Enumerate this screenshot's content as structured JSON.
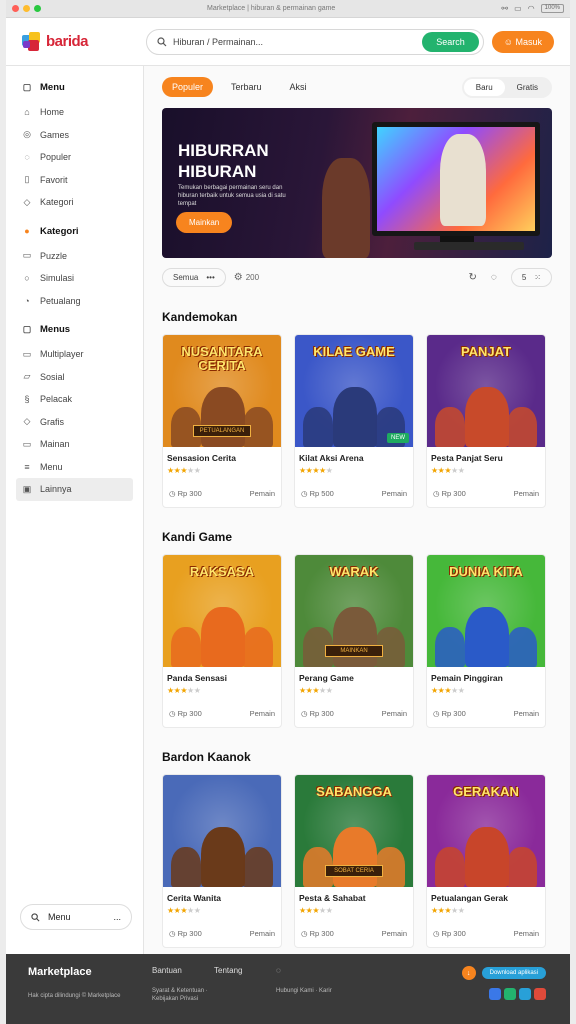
{
  "titlebar": {
    "traffic_lights": [
      "#ff5f57",
      "#febc2e",
      "#28c840"
    ],
    "title": "Marketplace | hiburan & permainan game",
    "status_battery": "100%"
  },
  "header": {
    "brand": "barida",
    "search_placeholder": "Hiburan / Permainan...",
    "search_button": "Search",
    "account_button": "Masuk"
  },
  "sidebar": {
    "section1_title": "Menu",
    "section1_items": [
      "Home",
      "Games",
      "Populer",
      "Favorit",
      "Kategori"
    ],
    "section2_title": "Kategori",
    "section2_items": [
      "Puzzle",
      "Simulasi",
      "Petualang"
    ],
    "section3_title": "Menus",
    "section3_items": [
      "Multiplayer",
      "Sosial",
      "Pelacak",
      "Grafis",
      "Mainan",
      "Menu",
      "Lainnya"
    ],
    "footer_label": "Menu",
    "footer_more": "..."
  },
  "tabs": {
    "items": [
      "Populer",
      "Terbaru",
      "Aksi"
    ],
    "segment": [
      "Baru",
      "Gratis"
    ]
  },
  "hero": {
    "title_line1": "HIBURRAN",
    "title_line2": "HIBURAN",
    "subtitle": "Temukan berbagai permainan seru dan hiburan terbaik untuk semua usia di satu tempat",
    "cta": "Mainkan"
  },
  "controls": {
    "filter_label": "Semua",
    "filter_more": "•••",
    "count": "200",
    "page_indicator": "5"
  },
  "sections": [
    {
      "title": "Kandemokan",
      "cards": [
        {
          "art": "NUSANTARA CERITA",
          "plaque": "PETUALANGAN",
          "name": "Sensasion Cerita",
          "rating": 3,
          "tag": "",
          "left": "Rp 300",
          "right": "Pemain",
          "bg": "#e08a1e",
          "fig": "#8a4a22"
        },
        {
          "art": "KILAE GAME",
          "plaque": "",
          "name": "Kilat Aksi Arena",
          "rating": 4,
          "tag": "NEW",
          "left": "Rp 500",
          "right": "Pemain",
          "bg": "#3b57c8",
          "fig": "#2a3a7a"
        },
        {
          "art": "PANJAT",
          "plaque": "",
          "name": "Pesta Panjat Seru",
          "rating": 3,
          "tag": "",
          "left": "Rp 300",
          "right": "Pemain",
          "bg": "#5a2a8a",
          "fig": "#c84a2a"
        }
      ]
    },
    {
      "title": "Kandi Game",
      "cards": [
        {
          "art": "RAKSASA",
          "plaque": "",
          "name": "Panda Sensasi",
          "rating": 3,
          "tag": "",
          "left": "Rp 300",
          "right": "Pemain",
          "bg": "#e8a020",
          "fig": "#e86a1e"
        },
        {
          "art": "WARAK",
          "plaque": "MAINKAN",
          "name": "Perang Game",
          "rating": 3,
          "tag": "",
          "left": "Rp 300",
          "right": "Pemain",
          "bg": "#4e8a3a",
          "fig": "#7a5a3a"
        },
        {
          "art": "DUNIA KITA",
          "plaque": "",
          "name": "Pemain Pinggiran",
          "rating": 3,
          "tag": "",
          "left": "Rp 300",
          "right": "Pemain",
          "bg": "#46b83a",
          "fig": "#2a5ac8"
        }
      ]
    },
    {
      "title": "Bardon Kaanok",
      "cards": [
        {
          "art": "",
          "plaque": "",
          "name": "Cerita Wanita",
          "rating": 3,
          "tag": "",
          "left": "Rp 300",
          "right": "Pemain",
          "bg": "#4a6ab8",
          "fig": "#6a3a1a"
        },
        {
          "art": "SABANGGA",
          "plaque": "SOBAT CERIA",
          "name": "Pesta & Sahabat",
          "rating": 3,
          "tag": "",
          "left": "Rp 300",
          "right": "Pemain",
          "bg": "#2a7a3a",
          "fig": "#e87a2a"
        },
        {
          "art": "GERAKAN",
          "plaque": "",
          "name": "Petualangan Gerak",
          "rating": 3,
          "tag": "",
          "left": "Rp 300",
          "right": "Pemain",
          "bg": "#8a2a9a",
          "fig": "#c8452a"
        }
      ]
    }
  ],
  "footer": {
    "brand": "Marketplace",
    "brand_small": "Hak cipta dilindungi © Marketplace",
    "col1_title": "Bantuan",
    "col1_small": "Syarat & Ketentuan · Kebijakan Privasi",
    "col2_title": "Tentang",
    "col3_small": "Hubungi Kami · Karir",
    "app_label": "Download aplikasi"
  }
}
